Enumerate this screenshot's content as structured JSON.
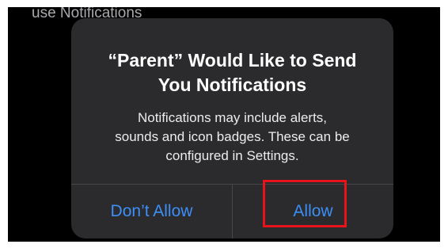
{
  "background": {
    "visible_text": "use Notifications"
  },
  "alert": {
    "title_line1": "“Parent” Would Like to Send",
    "title_line2": "You Notifications",
    "message_line1": "Notifications may include alerts,",
    "message_line2": "sounds and icon badges. These can be",
    "message_line3": "configured in Settings.",
    "deny_label": "Don’t Allow",
    "allow_label": "Allow"
  },
  "colors": {
    "accent": "#3d8ef7",
    "highlight": "#e8141c",
    "alert_background": "#2b2b2d"
  }
}
